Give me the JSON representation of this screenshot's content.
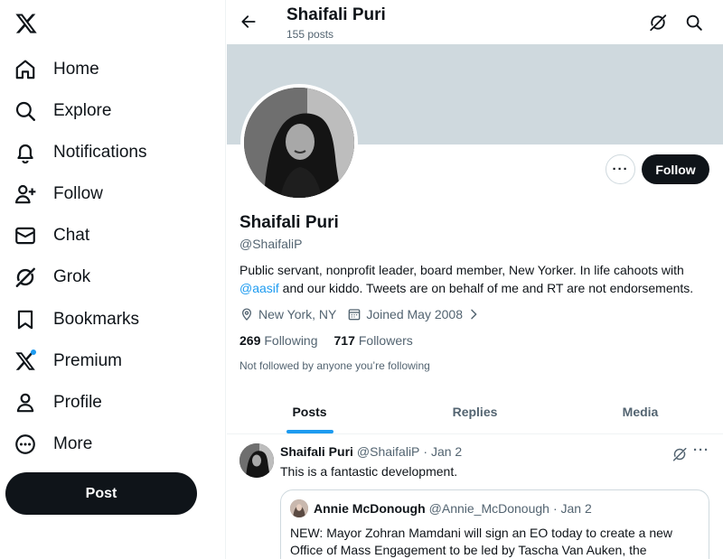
{
  "nav": {
    "items": [
      {
        "label": "Home",
        "icon": "home-icon"
      },
      {
        "label": "Explore",
        "icon": "search-icon"
      },
      {
        "label": "Notifications",
        "icon": "bell-icon"
      },
      {
        "label": "Follow",
        "icon": "person-add-icon"
      },
      {
        "label": "Chat",
        "icon": "envelope-icon"
      },
      {
        "label": "Grok",
        "icon": "grok-icon"
      },
      {
        "label": "Bookmarks",
        "icon": "bookmark-icon"
      },
      {
        "label": "Premium",
        "icon": "x-logo-icon"
      },
      {
        "label": "Profile",
        "icon": "person-icon"
      },
      {
        "label": "More",
        "icon": "more-circle-icon"
      }
    ],
    "post_label": "Post"
  },
  "header": {
    "name": "Shaifali Puri",
    "posts_count": "155 posts"
  },
  "profile": {
    "name": "Shaifali Puri",
    "handle": "@ShaifaliP",
    "bio_before": "Public servant, nonprofit leader, board member, New Yorker. In life cahoots with ",
    "bio_link": "@aasif",
    "bio_after": " and our kiddo. Tweets are on behalf of me and RT are not endorsements.",
    "location": "New York, NY",
    "joined": "Joined May 2008",
    "following_count": "269",
    "following_label": "Following",
    "followers_count": "717",
    "followers_label": "Followers",
    "not_followed": "Not followed by anyone you’re following",
    "follow_label": "Follow",
    "more_label": "···"
  },
  "tabs": [
    {
      "label": "Posts",
      "active": true
    },
    {
      "label": "Replies",
      "active": false
    },
    {
      "label": "Media",
      "active": false
    }
  ],
  "tweet": {
    "name": "Shaifali Puri",
    "handle": "@ShaifaliP",
    "date": "· Jan 2",
    "text": "This is a fantastic development.",
    "more_label": "···",
    "quote": {
      "name": "Annie McDonough",
      "handle": "@Annie_McDonough",
      "date": "· Jan 2",
      "text": "NEW: Mayor Zohran Mamdani will sign an EO today to create a new Office of Mass Engagement to be led by Tascha Van Auken, the"
    }
  },
  "colors": {
    "accent": "#1d9bf0",
    "text": "#0f1419",
    "muted": "#536471",
    "banner": "#cfd9de"
  }
}
